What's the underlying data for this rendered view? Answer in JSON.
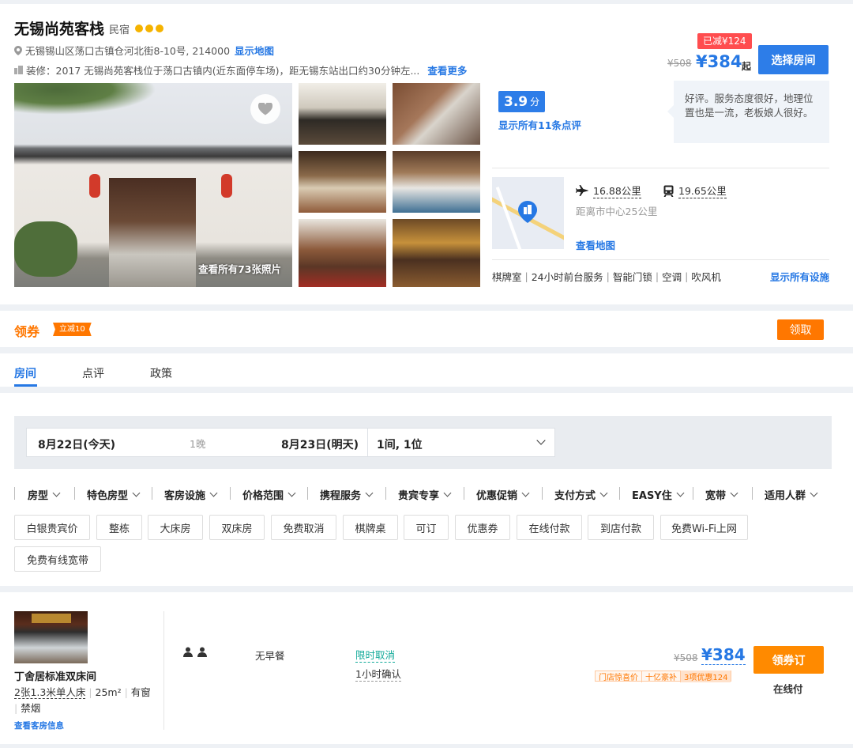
{
  "hotel": {
    "name": "无锡尚苑客栈",
    "type": "民宿",
    "address": "无锡锡山区荡口古镇仓河北街8-10号, 214000",
    "show_map": "显示地图",
    "desc": "装修：2017  无锡尚苑客栈位于荡口古镇内(近东面停车场)，距无锡东站出口约30分钟左...",
    "see_more": "查看更多",
    "photos_label": "查看所有73张照片"
  },
  "price_box": {
    "discount_badge": "已减¥124",
    "old_price": "¥508",
    "price": "¥384",
    "suffix": "起",
    "select_room": "选择房间"
  },
  "review": {
    "score": "3.9",
    "score_unit": "分",
    "show_all": "显示所有11条点评",
    "quote": "好评。服务态度很好，地理位置也是一流，老板娘人很好。"
  },
  "location": {
    "airport_dist": "16.88公里",
    "train_dist": "19.65公里",
    "center_dist": "距离市中心25公里",
    "view_map": "查看地图"
  },
  "facilities": {
    "items": [
      "棋牌室",
      "24小时前台服务",
      "智能门锁",
      "空调",
      "吹风机"
    ],
    "show_all": "显示所有设施"
  },
  "coupon": {
    "title": "领券",
    "badge": "立减10",
    "claim": "领取"
  },
  "tabs": [
    "房间",
    "点评",
    "政策"
  ],
  "search": {
    "checkin": "8月22日(今天)",
    "nights": "1晚",
    "checkout": "8月23日(明天)",
    "guests": "1间, 1位"
  },
  "filters": [
    "房型",
    "特色房型",
    "客房设施",
    "价格范围",
    "携程服务",
    "贵宾专享",
    "优惠促销",
    "支付方式",
    "EASY住",
    "宽带",
    "适用人群"
  ],
  "tags": [
    "白银贵宾价",
    "整栋",
    "大床房",
    "双床房",
    "免费取消",
    "棋牌桌",
    "可订",
    "优惠券",
    "在线付款",
    "到店付款",
    "免费Wi-Fi上网",
    "免费有线宽带"
  ],
  "room": {
    "name": "丁舍居标准双床间",
    "beds": "2张1.3米单人床",
    "area": "25m²",
    "window": "有窗",
    "smoking": "禁烟",
    "view_info": "查看客房信息",
    "breakfast": "无早餐",
    "cancel": "限时取消",
    "confirm": "1小时确认",
    "old_price": "¥508",
    "price": "¥384",
    "promo_tags": [
      "门店惊喜价",
      "十亿豪补",
      "3项优惠124"
    ],
    "book": "领券订",
    "pay": "在线付"
  },
  "colors": {
    "accent_blue": "#2678e4",
    "orange": "#ff7700",
    "red_badge": "#ff4d4f"
  }
}
